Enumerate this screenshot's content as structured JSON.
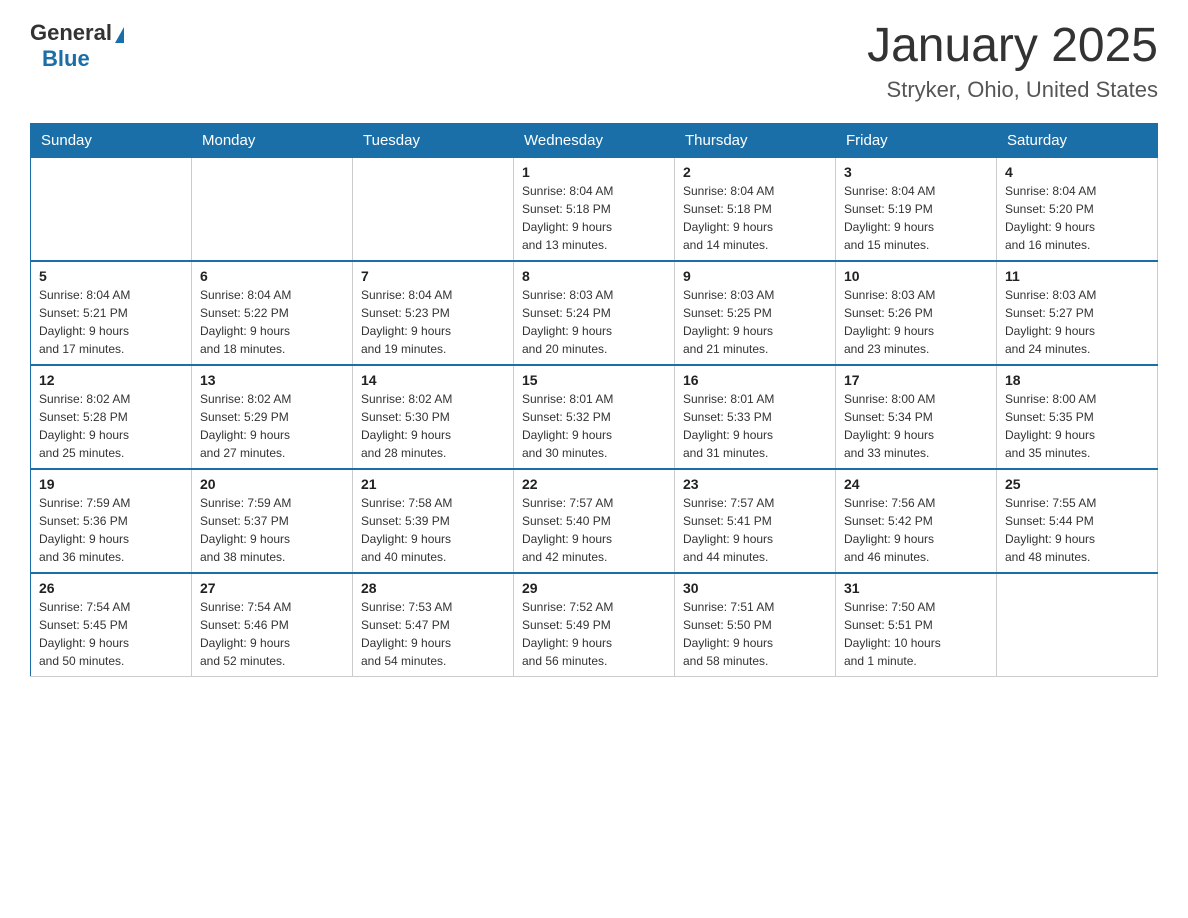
{
  "header": {
    "logo": {
      "general": "General",
      "blue": "Blue"
    },
    "title": "January 2025",
    "subtitle": "Stryker, Ohio, United States"
  },
  "calendar": {
    "days_of_week": [
      "Sunday",
      "Monday",
      "Tuesday",
      "Wednesday",
      "Thursday",
      "Friday",
      "Saturday"
    ],
    "weeks": [
      [
        {
          "day": "",
          "info": ""
        },
        {
          "day": "",
          "info": ""
        },
        {
          "day": "",
          "info": ""
        },
        {
          "day": "1",
          "info": "Sunrise: 8:04 AM\nSunset: 5:18 PM\nDaylight: 9 hours\nand 13 minutes."
        },
        {
          "day": "2",
          "info": "Sunrise: 8:04 AM\nSunset: 5:18 PM\nDaylight: 9 hours\nand 14 minutes."
        },
        {
          "day": "3",
          "info": "Sunrise: 8:04 AM\nSunset: 5:19 PM\nDaylight: 9 hours\nand 15 minutes."
        },
        {
          "day": "4",
          "info": "Sunrise: 8:04 AM\nSunset: 5:20 PM\nDaylight: 9 hours\nand 16 minutes."
        }
      ],
      [
        {
          "day": "5",
          "info": "Sunrise: 8:04 AM\nSunset: 5:21 PM\nDaylight: 9 hours\nand 17 minutes."
        },
        {
          "day": "6",
          "info": "Sunrise: 8:04 AM\nSunset: 5:22 PM\nDaylight: 9 hours\nand 18 minutes."
        },
        {
          "day": "7",
          "info": "Sunrise: 8:04 AM\nSunset: 5:23 PM\nDaylight: 9 hours\nand 19 minutes."
        },
        {
          "day": "8",
          "info": "Sunrise: 8:03 AM\nSunset: 5:24 PM\nDaylight: 9 hours\nand 20 minutes."
        },
        {
          "day": "9",
          "info": "Sunrise: 8:03 AM\nSunset: 5:25 PM\nDaylight: 9 hours\nand 21 minutes."
        },
        {
          "day": "10",
          "info": "Sunrise: 8:03 AM\nSunset: 5:26 PM\nDaylight: 9 hours\nand 23 minutes."
        },
        {
          "day": "11",
          "info": "Sunrise: 8:03 AM\nSunset: 5:27 PM\nDaylight: 9 hours\nand 24 minutes."
        }
      ],
      [
        {
          "day": "12",
          "info": "Sunrise: 8:02 AM\nSunset: 5:28 PM\nDaylight: 9 hours\nand 25 minutes."
        },
        {
          "day": "13",
          "info": "Sunrise: 8:02 AM\nSunset: 5:29 PM\nDaylight: 9 hours\nand 27 minutes."
        },
        {
          "day": "14",
          "info": "Sunrise: 8:02 AM\nSunset: 5:30 PM\nDaylight: 9 hours\nand 28 minutes."
        },
        {
          "day": "15",
          "info": "Sunrise: 8:01 AM\nSunset: 5:32 PM\nDaylight: 9 hours\nand 30 minutes."
        },
        {
          "day": "16",
          "info": "Sunrise: 8:01 AM\nSunset: 5:33 PM\nDaylight: 9 hours\nand 31 minutes."
        },
        {
          "day": "17",
          "info": "Sunrise: 8:00 AM\nSunset: 5:34 PM\nDaylight: 9 hours\nand 33 minutes."
        },
        {
          "day": "18",
          "info": "Sunrise: 8:00 AM\nSunset: 5:35 PM\nDaylight: 9 hours\nand 35 minutes."
        }
      ],
      [
        {
          "day": "19",
          "info": "Sunrise: 7:59 AM\nSunset: 5:36 PM\nDaylight: 9 hours\nand 36 minutes."
        },
        {
          "day": "20",
          "info": "Sunrise: 7:59 AM\nSunset: 5:37 PM\nDaylight: 9 hours\nand 38 minutes."
        },
        {
          "day": "21",
          "info": "Sunrise: 7:58 AM\nSunset: 5:39 PM\nDaylight: 9 hours\nand 40 minutes."
        },
        {
          "day": "22",
          "info": "Sunrise: 7:57 AM\nSunset: 5:40 PM\nDaylight: 9 hours\nand 42 minutes."
        },
        {
          "day": "23",
          "info": "Sunrise: 7:57 AM\nSunset: 5:41 PM\nDaylight: 9 hours\nand 44 minutes."
        },
        {
          "day": "24",
          "info": "Sunrise: 7:56 AM\nSunset: 5:42 PM\nDaylight: 9 hours\nand 46 minutes."
        },
        {
          "day": "25",
          "info": "Sunrise: 7:55 AM\nSunset: 5:44 PM\nDaylight: 9 hours\nand 48 minutes."
        }
      ],
      [
        {
          "day": "26",
          "info": "Sunrise: 7:54 AM\nSunset: 5:45 PM\nDaylight: 9 hours\nand 50 minutes."
        },
        {
          "day": "27",
          "info": "Sunrise: 7:54 AM\nSunset: 5:46 PM\nDaylight: 9 hours\nand 52 minutes."
        },
        {
          "day": "28",
          "info": "Sunrise: 7:53 AM\nSunset: 5:47 PM\nDaylight: 9 hours\nand 54 minutes."
        },
        {
          "day": "29",
          "info": "Sunrise: 7:52 AM\nSunset: 5:49 PM\nDaylight: 9 hours\nand 56 minutes."
        },
        {
          "day": "30",
          "info": "Sunrise: 7:51 AM\nSunset: 5:50 PM\nDaylight: 9 hours\nand 58 minutes."
        },
        {
          "day": "31",
          "info": "Sunrise: 7:50 AM\nSunset: 5:51 PM\nDaylight: 10 hours\nand 1 minute."
        },
        {
          "day": "",
          "info": ""
        }
      ]
    ]
  }
}
